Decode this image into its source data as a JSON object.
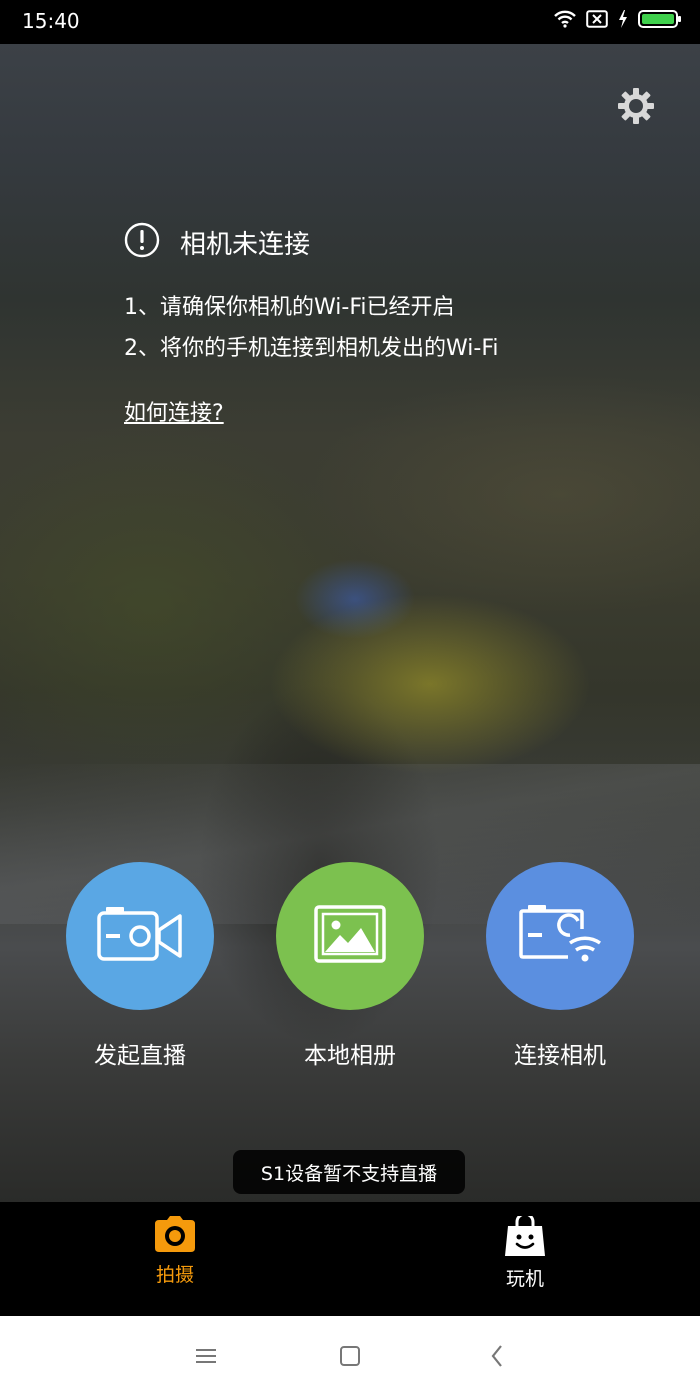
{
  "status_bar": {
    "time": "15:40",
    "icons": [
      "wifi-icon",
      "sim-none-icon",
      "charging-icon",
      "battery-icon"
    ],
    "battery_color": "#3fd04c"
  },
  "main": {
    "settings_icon": "gear-icon",
    "connection_status": {
      "icon": "alert-circle-icon",
      "title": "相机未连接",
      "steps": [
        "1、请确保你相机的Wi-Fi已经开启",
        "2、将你的手机连接到相机发出的Wi-Fi"
      ],
      "help_link": "如何连接?"
    },
    "actions": [
      {
        "label": "发起直播",
        "icon": "video-camera-icon",
        "color": "#5aa7e4"
      },
      {
        "label": "本地相册",
        "icon": "photo-album-icon",
        "color": "#7cc14f"
      },
      {
        "label": "连接相机",
        "icon": "camera-wifi-icon",
        "color": "#5b8fe0"
      }
    ],
    "toast": "S1设备暂不支持直播"
  },
  "tab_bar": {
    "tabs": [
      {
        "label": "拍摄",
        "icon": "camera-icon",
        "active": true,
        "color": "#f59a0c"
      },
      {
        "label": "玩机",
        "icon": "shopping-bag-icon",
        "active": false,
        "color": "#ffffff"
      }
    ]
  },
  "nav_bar": {
    "buttons": [
      "menu-icon",
      "home-icon",
      "back-icon"
    ]
  }
}
